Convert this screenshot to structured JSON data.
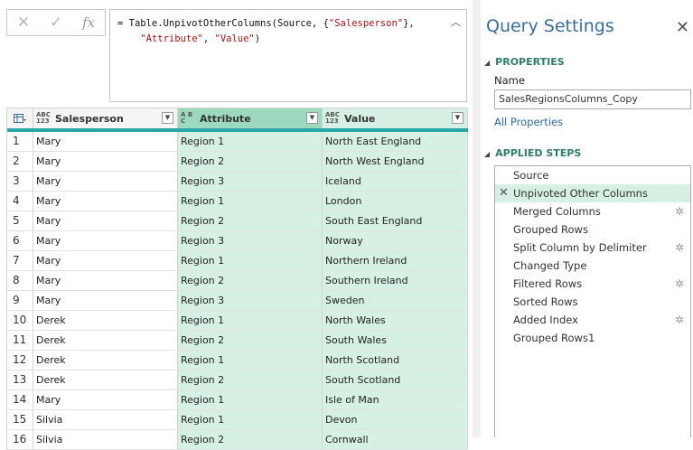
{
  "formula_bar": {
    "cancel_icon": "✕",
    "commit_icon": "✓",
    "fx_label": "fx",
    "line1_prefix": "= Table.UnpivotOtherColumns(Source, {",
    "line1_string": "\"Salesperson\"",
    "line1_suffix": "},",
    "line2_string_a": "\"Attribute\"",
    "line2_sep": ", ",
    "line2_string_b": "\"Value\"",
    "line2_suffix": ")",
    "collapse_icon": "︿"
  },
  "grid": {
    "columns": [
      {
        "type_top": "ABC",
        "type_bottom": "123",
        "label": "Salesperson"
      },
      {
        "type_top": "A B",
        "type_bottom": "C",
        "label": "Attribute"
      },
      {
        "type_top": "ABC",
        "type_bottom": "123",
        "label": "Value"
      }
    ],
    "rows": [
      {
        "n": "1",
        "salesperson": "Mary",
        "attribute": "Region 1",
        "value": "North East England"
      },
      {
        "n": "2",
        "salesperson": "Mary",
        "attribute": "Region 2",
        "value": "North West England"
      },
      {
        "n": "3",
        "salesperson": "Mary",
        "attribute": "Region 3",
        "value": "Iceland"
      },
      {
        "n": "4",
        "salesperson": "Mary",
        "attribute": "Region 1",
        "value": "London"
      },
      {
        "n": "5",
        "salesperson": "Mary",
        "attribute": "Region 2",
        "value": "South East England"
      },
      {
        "n": "6",
        "salesperson": "Mary",
        "attribute": "Region 3",
        "value": "Norway"
      },
      {
        "n": "7",
        "salesperson": "Mary",
        "attribute": "Region 1",
        "value": "Northern Ireland"
      },
      {
        "n": "8",
        "salesperson": "Mary",
        "attribute": "Region 2",
        "value": "Southern Ireland"
      },
      {
        "n": "9",
        "salesperson": "Mary",
        "attribute": "Region 3",
        "value": "Sweden"
      },
      {
        "n": "10",
        "salesperson": "Derek",
        "attribute": "Region 1",
        "value": "North Wales"
      },
      {
        "n": "11",
        "salesperson": "Derek",
        "attribute": "Region 2",
        "value": "South Wales"
      },
      {
        "n": "12",
        "salesperson": "Derek",
        "attribute": "Region 1",
        "value": "North Scotland"
      },
      {
        "n": "13",
        "salesperson": "Derek",
        "attribute": "Region 2",
        "value": "South Scotland"
      },
      {
        "n": "14",
        "salesperson": "Mary",
        "attribute": "Region 1",
        "value": "Isle of Man"
      },
      {
        "n": "15",
        "salesperson": "Silvia",
        "attribute": "Region 1",
        "value": "Devon"
      },
      {
        "n": "16",
        "salesperson": "Silvia",
        "attribute": "Region 2",
        "value": "Cornwall"
      }
    ]
  },
  "query_settings": {
    "title": "Query Settings",
    "close_icon": "✕",
    "properties_heading": "PROPERTIES",
    "name_label": "Name",
    "name_value": "SalesRegionsColumns_Copy",
    "all_properties_link": "All Properties",
    "applied_steps_heading": "APPLIED STEPS",
    "steps": [
      {
        "label": "Source",
        "gear": ""
      },
      {
        "label": "Unpivoted Other Columns",
        "gear": ""
      },
      {
        "label": "Merged Columns",
        "gear": "✲"
      },
      {
        "label": "Grouped Rows",
        "gear": ""
      },
      {
        "label": "Split Column by Delimiter",
        "gear": "✲"
      },
      {
        "label": "Changed Type",
        "gear": ""
      },
      {
        "label": "Filtered Rows",
        "gear": "✲"
      },
      {
        "label": "Sorted Rows",
        "gear": ""
      },
      {
        "label": "Added Index",
        "gear": "✲"
      },
      {
        "label": "Grouped Rows1",
        "gear": ""
      }
    ],
    "active_step_delete_icon": "✕"
  },
  "colors": {
    "accent_teal": "#2aa6a6",
    "selected_column": "#d7f0e4",
    "title_blue": "#3b6d9a"
  }
}
